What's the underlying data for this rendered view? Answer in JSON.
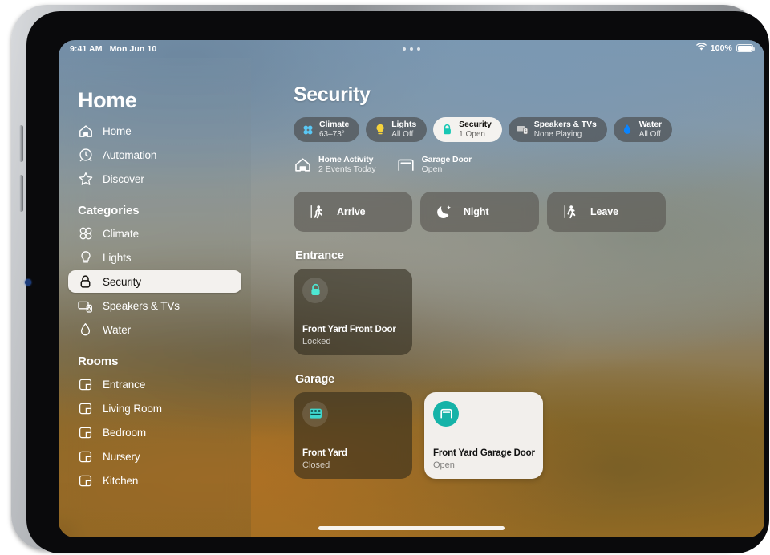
{
  "status_bar": {
    "time": "9:41 AM",
    "date": "Mon Jun 10",
    "wifi_icon": "wifi-icon",
    "battery_percent": "100%",
    "battery_icon": "battery-icon",
    "multitask_icon": "multitasking-dots-icon"
  },
  "sidebar": {
    "title": "Home",
    "top_items": [
      {
        "label": "Home",
        "icon": "house-icon"
      },
      {
        "label": "Automation",
        "icon": "clock-icon"
      },
      {
        "label": "Discover",
        "icon": "star-icon"
      }
    ],
    "categories_header": "Categories",
    "categories": [
      {
        "label": "Climate",
        "icon": "fan-icon",
        "selected": false
      },
      {
        "label": "Lights",
        "icon": "lightbulb-icon",
        "selected": false
      },
      {
        "label": "Security",
        "icon": "lock-icon",
        "selected": true
      },
      {
        "label": "Speakers & TVs",
        "icon": "tv-speaker-icon",
        "selected": false
      },
      {
        "label": "Water",
        "icon": "water-drop-icon",
        "selected": false
      }
    ],
    "rooms_header": "Rooms",
    "rooms": [
      {
        "label": "Entrance",
        "icon": "room-icon"
      },
      {
        "label": "Living Room",
        "icon": "room-icon"
      },
      {
        "label": "Bedroom",
        "icon": "room-icon"
      },
      {
        "label": "Nursery",
        "icon": "room-icon"
      },
      {
        "label": "Kitchen",
        "icon": "room-icon"
      }
    ]
  },
  "main": {
    "page_title": "Security",
    "status_pills": [
      {
        "title": "Climate",
        "subtitle": "63–73°",
        "icon": "fan-icon",
        "icon_color": "#5ac8f5",
        "selected": false
      },
      {
        "title": "Lights",
        "subtitle": "All Off",
        "icon": "lightbulb-icon",
        "icon_color": "#f6d33c",
        "selected": false
      },
      {
        "title": "Security",
        "subtitle": "1 Open",
        "icon": "lock-icon",
        "icon_color": "#17c7b4",
        "selected": true
      },
      {
        "title": "Speakers & TVs",
        "subtitle": "None Playing",
        "icon": "tv-speaker-icon",
        "icon_color": "#c9c9c9",
        "selected": false
      },
      {
        "title": "Water",
        "subtitle": "All Off",
        "icon": "water-drop-icon",
        "icon_color": "#0a84ff",
        "selected": false
      }
    ],
    "status_items": [
      {
        "title": "Home Activity",
        "subtitle": "2 Events Today",
        "icon": "house-icon"
      },
      {
        "title": "Garage Door",
        "subtitle": "Open",
        "icon": "garage-door-icon"
      }
    ],
    "scenes": [
      {
        "label": "Arrive",
        "icon": "person-arrive-icon"
      },
      {
        "label": "Night",
        "icon": "moon-icon"
      },
      {
        "label": "Leave",
        "icon": "person-leave-icon"
      }
    ],
    "sections": [
      {
        "title": "Entrance",
        "tiles": [
          {
            "name": "Front Yard Front Door",
            "state": "Locked",
            "icon": "lock-icon",
            "accent": "#4de8d4",
            "on": false
          }
        ]
      },
      {
        "title": "Garage",
        "tiles": [
          {
            "name": "Front Yard",
            "state": "Closed",
            "icon": "garage-camera-icon",
            "accent": "#3fd6cd",
            "on": false
          },
          {
            "name": "Front Yard Garage Door",
            "state": "Open",
            "icon": "garage-door-icon",
            "accent": "#16b3a8",
            "on": true
          }
        ]
      }
    ]
  },
  "colors": {
    "accent_teal": "#16b3a8",
    "selected_pill_bg": "#f3f1ee",
    "active_tile_bg": "#f2efec"
  }
}
